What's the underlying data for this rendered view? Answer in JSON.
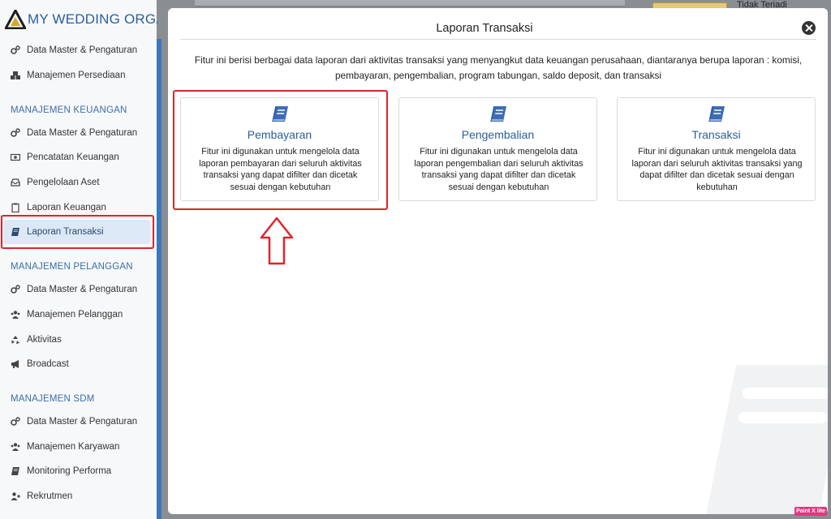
{
  "brand": {
    "name": "MY WEDDING ORGANI"
  },
  "sidebar": {
    "top_items": [
      {
        "label": "Data Master & Pengaturan",
        "icon": "gears-icon"
      },
      {
        "label": "Manajemen Persediaan",
        "icon": "cubes-icon"
      }
    ],
    "sections": [
      {
        "title": "MANAJEMEN KEUANGAN",
        "items": [
          {
            "label": "Data Master & Pengaturan",
            "icon": "gears-icon"
          },
          {
            "label": "Pencatatan Keuangan",
            "icon": "money-icon"
          },
          {
            "label": "Pengelolaan Aset",
            "icon": "inbox-icon"
          },
          {
            "label": "Laporan Keuangan",
            "icon": "clipboard-icon"
          },
          {
            "label": "Laporan Transaksi",
            "icon": "book-icon",
            "active": true
          }
        ]
      },
      {
        "title": "MANAJEMEN PELANGGAN",
        "items": [
          {
            "label": "Data Master & Pengaturan",
            "icon": "gears-icon"
          },
          {
            "label": "Manajemen Pelanggan",
            "icon": "users-icon"
          },
          {
            "label": "Aktivitas",
            "icon": "recycle-icon"
          },
          {
            "label": "Broadcast",
            "icon": "bullhorn-icon"
          }
        ]
      },
      {
        "title": "MANAJEMEN SDM",
        "items": [
          {
            "label": "Data Master & Pengaturan",
            "icon": "gears-icon"
          },
          {
            "label": "Manajemen Karyawan",
            "icon": "users-icon"
          },
          {
            "label": "Monitoring Performa",
            "icon": "book-icon"
          },
          {
            "label": "Rekrutmen",
            "icon": "user-plus-icon"
          }
        ]
      }
    ]
  },
  "background": {
    "status_text": "Tidak Terjadi"
  },
  "modal": {
    "title": "Laporan Transaksi",
    "description": "Fitur ini berisi berbagai data laporan dari aktivitas transaksi yang menyangkut data keuangan perusahaan, diantaranya berupa laporan : komisi, pembayaran, pengembalian, program tabungan, saldo deposit, dan transaksi",
    "cards": [
      {
        "title": "Pembayaran",
        "text": "Fitur ini digunakan untuk mengelola data laporan pembayaran dari seluruh aktivitas transaksi yang dapat difilter dan dicetak sesuai dengan kebutuhan",
        "icon": "book-icon"
      },
      {
        "title": "Pengembalian",
        "text": "Fitur ini digunakan untuk mengelola data laporan pengembalian dari seluruh aktivitas transaksi yang dapat difilter dan dicetak sesuai dengan kebutuhan",
        "icon": "book-icon"
      },
      {
        "title": "Transaksi",
        "text": "Fitur ini digunakan untuk mengelola data laporan dari seluruh aktivitas transaksi yang dapat difilter dan dicetak sesuai dengan kebutuhan",
        "icon": "book-icon"
      }
    ]
  },
  "colors": {
    "accent": "#2b5d9c",
    "highlight": "#e0242c",
    "sidebar_edge": "#3a78bd"
  },
  "badge": {
    "label": "Paint X lite"
  }
}
